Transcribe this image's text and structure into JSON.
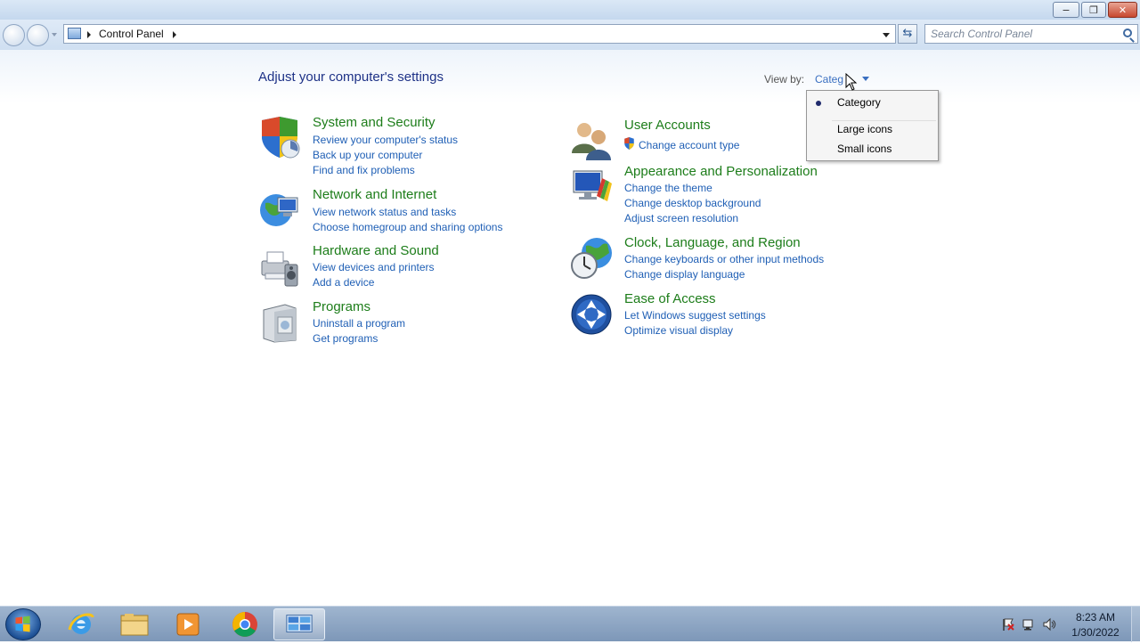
{
  "window": {
    "buttons": {
      "minimize": "−",
      "maximize": "❐",
      "close": "✕"
    }
  },
  "address_bar": {
    "path": "Control Panel",
    "search_placeholder": "Search Control Panel"
  },
  "header": {
    "title": "Adjust your computer's settings",
    "view_by_label": "View by:",
    "view_by_value": "Categ"
  },
  "categories": [
    {
      "icon": "shield-computer-icon",
      "title": "System and Security",
      "links": [
        "Review your computer's status",
        "Back up your computer",
        "Find and fix problems"
      ]
    },
    {
      "icon": "network-globe-icon",
      "title": "Network and Internet",
      "links": [
        "View network status and tasks",
        "Choose homegroup and sharing options"
      ]
    },
    {
      "icon": "printer-speaker-icon",
      "title": "Hardware and Sound",
      "links": [
        "View devices and printers",
        "Add a device"
      ]
    },
    {
      "icon": "programs-box-icon",
      "title": "Programs",
      "links": [
        "Uninstall a program",
        "Get programs"
      ]
    },
    {
      "icon": "users-icon",
      "title": "User Accounts",
      "links": [
        "Change account type"
      ]
    },
    {
      "icon": "monitor-paint-icon",
      "title": "Appearance and Personalization",
      "links": [
        "Change the theme",
        "Change desktop background",
        "Adjust screen resolution"
      ]
    },
    {
      "icon": "clock-globe-icon",
      "title": "Clock, Language, and Region",
      "links": [
        "Change keyboards or other input methods",
        "Change display language"
      ]
    },
    {
      "icon": "accessibility-icon",
      "title": "Ease of Access",
      "links": [
        "Let Windows suggest settings",
        "Optimize visual display"
      ]
    }
  ],
  "view_menu": {
    "items": [
      "Category",
      "Large icons",
      "Small icons"
    ],
    "selected": "Category"
  },
  "taskbar": {
    "apps": [
      "internet-explorer-icon",
      "file-explorer-icon",
      "media-player-icon",
      "chrome-icon",
      "control-panel-icon"
    ],
    "active": "control-panel-icon",
    "clock_time": "8:23 AM",
    "clock_date": "1/30/2022"
  },
  "colors": {
    "category_title": "#1d7d1a",
    "link": "#1f5fb5",
    "page_title": "#1e3287"
  }
}
